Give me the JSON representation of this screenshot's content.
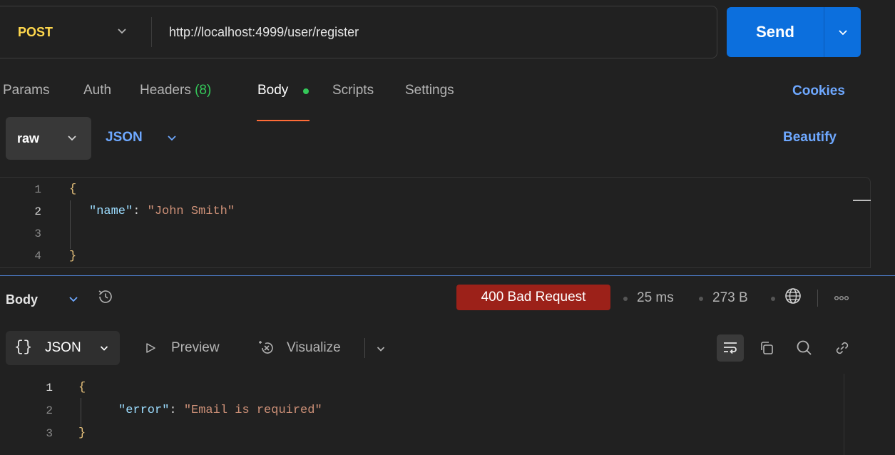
{
  "request": {
    "method": "POST",
    "url": "http://localhost:4999/user/register",
    "send_label": "Send"
  },
  "request_tabs": [
    {
      "label": "Params"
    },
    {
      "label": "Auth"
    },
    {
      "label": "Headers",
      "count": "(8)"
    },
    {
      "label": "Body",
      "active": true
    },
    {
      "label": "Scripts"
    },
    {
      "label": "Settings"
    }
  ],
  "cookies_label": "Cookies",
  "body_options": {
    "mode": "raw",
    "language": "JSON",
    "beautify_label": "Beautify"
  },
  "request_body": {
    "line_numbers": [
      "1",
      "2",
      "3",
      "4"
    ],
    "open_brace": "{",
    "key": "\"name\"",
    "colon": ": ",
    "value": "\"John Smith\"",
    "close_brace": "}"
  },
  "response": {
    "section_label": "Body",
    "status": "400 Bad Request",
    "time": "25 ms",
    "size": "273 B",
    "format_braces": "{}",
    "format_label": "JSON",
    "preview_label": "Preview",
    "visualize_label": "Visualize",
    "body": {
      "line_numbers": [
        "1",
        "2",
        "3"
      ],
      "open_brace": "{",
      "key": "\"error\"",
      "colon": ": ",
      "value": "\"Email is required\"",
      "close_brace": "}"
    }
  },
  "colors": {
    "method": "#ffd84d",
    "send": "#0c6fdd",
    "accent_link": "#6ea8ff",
    "active_tab_underline": "#ff6c37",
    "status_error": "#9c2119",
    "body_dot": "#34c759"
  },
  "icons": [
    "chevron-down-icon",
    "history-icon",
    "globe-icon",
    "more-icon",
    "play-icon",
    "visualize-icon",
    "wrap-icon",
    "copy-icon",
    "search-icon",
    "link-icon"
  ]
}
